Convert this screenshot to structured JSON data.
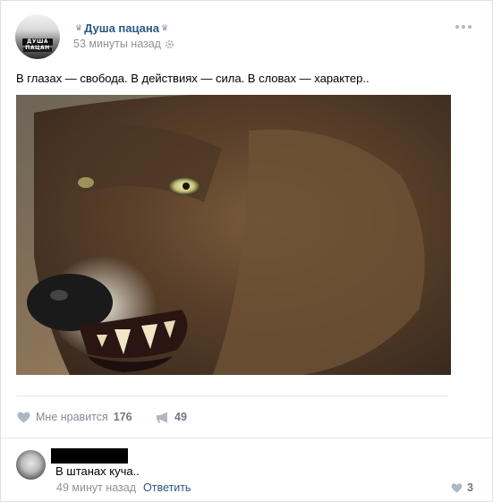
{
  "post": {
    "author": "Душа пацана",
    "avatar_text": "ДУША ПАЦАН",
    "time": "53 минуты назад",
    "text": "В глазах — свобода. В действиях — сила. В словах — характер..",
    "image_icon": "wolf-snarling-photo"
  },
  "actions": {
    "like_label": "Мне нравится",
    "like_count": "176",
    "share_count": "49"
  },
  "comment": {
    "text": "В штанах куча..",
    "time": "49 минут назад",
    "reply_label": "Ответить",
    "like_count": "3"
  },
  "colors": {
    "link": "#2a5885",
    "muted": "#939393",
    "icon": "#aeb7c2"
  }
}
